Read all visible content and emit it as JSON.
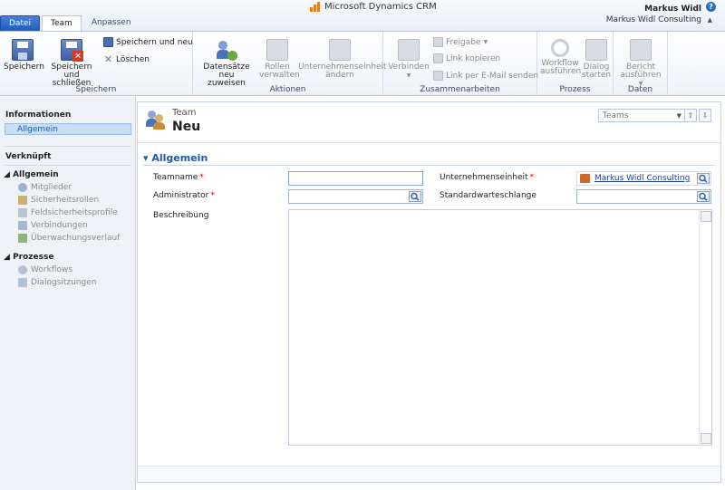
{
  "app": {
    "brand": "Microsoft Dynamics CRM",
    "user": "Markus Widl",
    "organization": "Markus Widl Consulting"
  },
  "tabs": [
    {
      "label": "Datei"
    },
    {
      "label": "Team"
    },
    {
      "label": "Anpassen"
    }
  ],
  "ribbon": {
    "save": {
      "label": "Speicherr",
      "save_label": "Speichern",
      "save_close_line1": "Speichern und",
      "save_close_line2": "schließen",
      "save_new": "Speichern und neu",
      "delete": "Löschen",
      "group": "Speichern"
    },
    "actions": {
      "reassign_line1": "Datensätze neu",
      "reassign_line2": "zuweisen",
      "roles_line1": "Rollen",
      "roles_line2": "verwalten",
      "bu_line1": "Unternehmenseinheit",
      "bu_line2": "ändern",
      "group": "Aktionen"
    },
    "collab": {
      "connect": "Verbinden",
      "share": "Freigabe",
      "copy_link": "Link kopieren",
      "email_link": "Link per E-Mail senden",
      "group": "Zusammenarbeiten"
    },
    "process": {
      "workflow_line1": "Workflow",
      "workflow_line2": "ausführen",
      "dialog_line1": "Dialog",
      "dialog_line2": "starten",
      "group": "Prozess"
    },
    "data": {
      "report_line1": "Bericht",
      "report_line2": "ausführen",
      "group": "Daten"
    }
  },
  "nav": {
    "info_heading": "Informationen",
    "general": "Allgemein",
    "related_heading": "Verknüpft",
    "group_general": "Allgemein",
    "items_general": [
      "Mitglieder",
      "Sicherheitsrollen",
      "Feldsicherheitsprofile",
      "Verbindungen",
      "Überwachungsverlauf"
    ],
    "group_processes": "Prozesse",
    "items_processes": [
      "Workflows",
      "Dialogsitzungen"
    ]
  },
  "form": {
    "entity": "Team",
    "title": "Neu",
    "selector_value": "Teams",
    "section": "Allgemein",
    "teamname_label": "Teamname",
    "teamname_value": "",
    "admin_label": "Administrator",
    "admin_value": "",
    "bu_label": "Unternehmenseinheit",
    "bu_value": "Markus Widl Consulting",
    "queue_label": "Standardwarteschlange",
    "queue_value": "",
    "desc_label": "Beschreibung",
    "desc_value": ""
  },
  "colors": {
    "accent": "#1e5aa8",
    "required": "#dd0000",
    "file_tab": "#2a64c5"
  }
}
